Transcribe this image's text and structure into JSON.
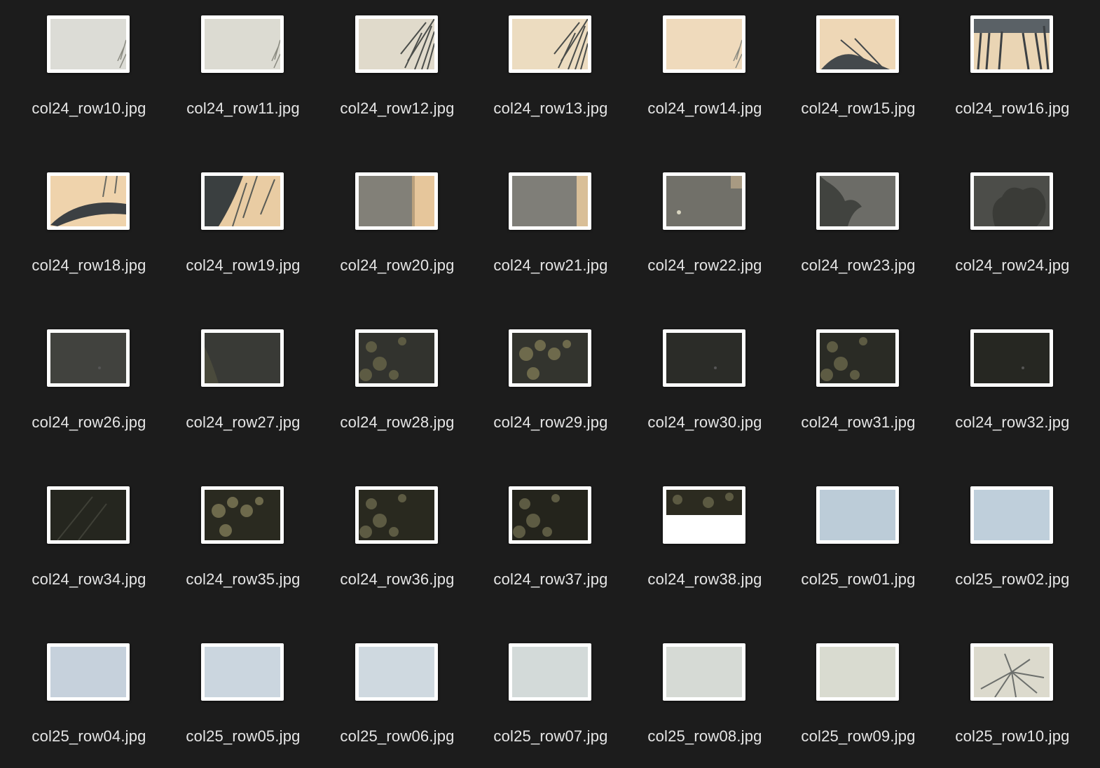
{
  "window": {
    "background": "#1c1c1c",
    "label_color": "#e6e6e6",
    "thumbnail_border": "#ffffff"
  },
  "files": [
    {
      "name": "col24_row10.jpg",
      "bg": "#dcdcd6",
      "art": "edge-frond"
    },
    {
      "name": "col24_row11.jpg",
      "bg": "#dcdbd2",
      "art": "edge-frond"
    },
    {
      "name": "col24_row12.jpg",
      "bg": "#e0dacb",
      "art": "frond-right"
    },
    {
      "name": "col24_row13.jpg",
      "bg": "#ecdcc0",
      "art": "frond-right"
    },
    {
      "name": "col24_row14.jpg",
      "bg": "#efdabc",
      "art": "edge-frond"
    },
    {
      "name": "col24_row15.jpg",
      "bg": "#eed7b6",
      "art": "frond-bottom"
    },
    {
      "name": "col24_row16.jpg",
      "bg": "#ead5b4",
      "art": "frond-top"
    },
    {
      "name": "col24_row18.jpg",
      "bg": "#efd3ac",
      "art": "leaf-dark"
    },
    {
      "name": "col24_row19.jpg",
      "bg": "#e9cca3",
      "art": "leaf-dark-2"
    },
    {
      "name": "col24_row20.jpg",
      "bg": "#828078",
      "art": "wall-right"
    },
    {
      "name": "col24_row21.jpg",
      "bg": "#7f7e78",
      "art": "wall-right-2"
    },
    {
      "name": "col24_row22.jpg",
      "bg": "#717069",
      "art": "gray-dot"
    },
    {
      "name": "col24_row23.jpg",
      "bg": "#6c6c67",
      "art": "tree-left"
    },
    {
      "name": "col24_row24.jpg",
      "bg": "#4c4d49",
      "art": "tree-full"
    },
    {
      "name": "col24_row26.jpg",
      "bg": "#41423e",
      "art": "dark-plain"
    },
    {
      "name": "col24_row27.jpg",
      "bg": "#393a36",
      "art": "dark-foliage"
    },
    {
      "name": "col24_row28.jpg",
      "bg": "#32332e",
      "art": "foliage"
    },
    {
      "name": "col24_row29.jpg",
      "bg": "#33342e",
      "art": "foliage-bright"
    },
    {
      "name": "col24_row30.jpg",
      "bg": "#2b2c28",
      "art": "dark-plain"
    },
    {
      "name": "col24_row31.jpg",
      "bg": "#2a2b25",
      "art": "foliage"
    },
    {
      "name": "col24_row32.jpg",
      "bg": "#262722",
      "art": "dark-plain"
    },
    {
      "name": "col24_row34.jpg",
      "bg": "#25261f",
      "art": "dark-branch"
    },
    {
      "name": "col24_row35.jpg",
      "bg": "#2a2a20",
      "art": "foliage-bright"
    },
    {
      "name": "col24_row36.jpg",
      "bg": "#29291f",
      "art": "foliage"
    },
    {
      "name": "col24_row37.jpg",
      "bg": "#24241c",
      "art": "foliage"
    },
    {
      "name": "col24_row38.jpg",
      "bg": "#ffffff",
      "art": "half-dark"
    },
    {
      "name": "col25_row01.jpg",
      "bg": "#bcccd8",
      "art": "plain"
    },
    {
      "name": "col25_row02.jpg",
      "bg": "#bfcfdb",
      "art": "plain"
    },
    {
      "name": "col25_row04.jpg",
      "bg": "#c6d1dc",
      "art": "plain"
    },
    {
      "name": "col25_row05.jpg",
      "bg": "#cbd6df",
      "art": "plain"
    },
    {
      "name": "col25_row06.jpg",
      "bg": "#cfd9e0",
      "art": "plain"
    },
    {
      "name": "col25_row07.jpg",
      "bg": "#d3dad9",
      "art": "plain"
    },
    {
      "name": "col25_row08.jpg",
      "bg": "#d6dad5",
      "art": "plain"
    },
    {
      "name": "col25_row09.jpg",
      "bg": "#d9dbd0",
      "art": "plain"
    },
    {
      "name": "col25_row10.jpg",
      "bg": "#dcdacd",
      "art": "frond-center"
    }
  ]
}
